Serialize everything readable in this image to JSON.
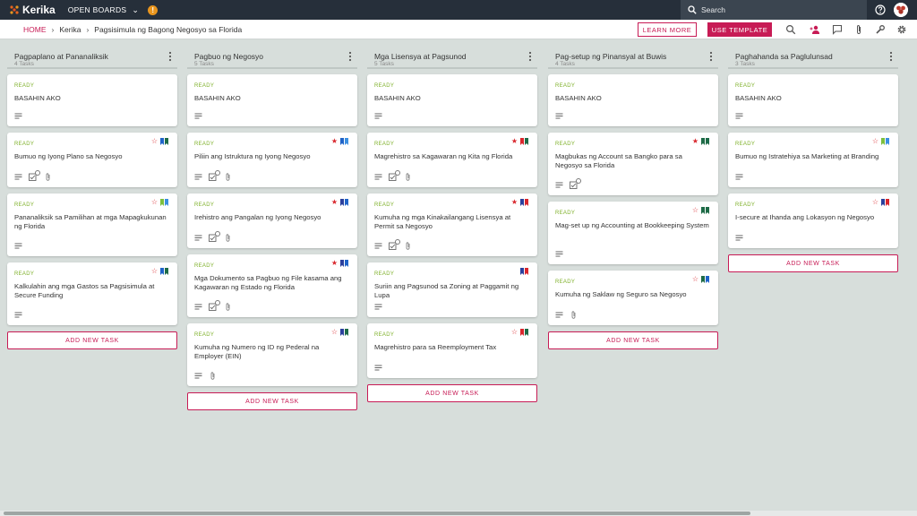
{
  "topbar": {
    "app_name": "Kerika",
    "open_boards_label": "OPEN BOARDS",
    "notification_badge": "!",
    "search_placeholder": "Search"
  },
  "breadcrumb": {
    "home": "HOME",
    "parent": "Kerika",
    "current": "Pagsisimula ng Bagong Negosyo sa Florida"
  },
  "actions": {
    "learn_more": "LEARN MORE",
    "use_template": "USE TEMPLATE"
  },
  "colors": {
    "accent": "#c71b55",
    "topbar": "#262f3a",
    "ready": "#7fb02a",
    "flag_blue": "#1e63c8",
    "flag_green": "#1e6b47",
    "flag_darkblue": "#2a3f9c",
    "flag_red": "#d9262c",
    "flag_lightgreen": "#7cbf3d",
    "flag_lightblue": "#3b8fe0",
    "star_red": "#d9262c"
  },
  "add_task_label": "ADD NEW TASK",
  "columns": [
    {
      "title": "Pagpaplano at Pananaliksik",
      "count": "4 Tasks",
      "cards": [
        {
          "status": "READY",
          "title": "BASAHIN AKO",
          "star": null,
          "flags": [],
          "icons": [
            "desc"
          ]
        },
        {
          "status": "READY",
          "title": "Bumuo ng Iyong Plano sa Negosyo",
          "star": "outline",
          "flags": [
            "#1e63c8",
            "#1e6b47"
          ],
          "icons": [
            "desc",
            "check",
            "attach"
          ]
        },
        {
          "status": "READY",
          "title": "Pananaliksik sa Pamilihan at mga Mapagkukunan ng Florida",
          "star": "outline",
          "flags": [
            "#7cbf3d",
            "#3b8fe0"
          ],
          "icons": [
            "desc"
          ]
        },
        {
          "status": "READY",
          "title": "Kalkulahin ang mga Gastos sa Pagsisimula at Secure Funding",
          "star": "outline",
          "flags": [
            "#1e63c8",
            "#1e6b47"
          ],
          "icons": [
            "desc"
          ]
        }
      ]
    },
    {
      "title": "Pagbuo ng Negosyo",
      "count": "5 Tasks",
      "cards": [
        {
          "status": "READY",
          "title": "BASAHIN AKO",
          "star": null,
          "flags": [],
          "icons": [
            "desc"
          ]
        },
        {
          "status": "READY",
          "title": "Piliin ang Istruktura ng Iyong Negosyo",
          "star": "filled",
          "flags": [
            "#1e63c8",
            "#3b8fe0"
          ],
          "icons": [
            "desc",
            "check",
            "attach"
          ]
        },
        {
          "status": "READY",
          "title": "Irehistro ang Pangalan ng Iyong Negosyo",
          "star": "filled",
          "flags": [
            "#2a3f9c",
            "#1e63c8"
          ],
          "icons": [
            "desc",
            "check",
            "attach"
          ]
        },
        {
          "status": "READY",
          "title": "Mga Dokumento sa Pagbuo ng File kasama ang Kagawaran ng Estado ng Florida",
          "star": "filled",
          "flags": [
            "#2a3f9c",
            "#1e63c8"
          ],
          "icons": [
            "desc",
            "check",
            "attach"
          ]
        },
        {
          "status": "READY",
          "title": "Kumuha ng Numero ng ID ng Pederal na Employer (EIN)",
          "star": "outline",
          "flags": [
            "#2a3f9c",
            "#1e6b47"
          ],
          "icons": [
            "desc",
            "attach"
          ]
        }
      ]
    },
    {
      "title": "Mga Lisensya at Pagsunod",
      "count": "5 Tasks",
      "cards": [
        {
          "status": "READY",
          "title": "BASAHIN AKO",
          "star": null,
          "flags": [],
          "icons": [
            "desc"
          ]
        },
        {
          "status": "READY",
          "title": "Magrehistro sa Kagawaran ng Kita ng Florida",
          "star": "filled",
          "flags": [
            "#d9262c",
            "#1e6b47"
          ],
          "icons": [
            "desc",
            "check",
            "attach"
          ]
        },
        {
          "status": "READY",
          "title": "Kumuha ng mga Kinakailangang Lisensya at Permit sa Negosyo",
          "star": "filled",
          "flags": [
            "#2a3f9c",
            "#d9262c"
          ],
          "icons": [
            "desc",
            "check",
            "attach"
          ]
        },
        {
          "status": "READY",
          "title": "Suriin ang Pagsunod sa Zoning at Paggamit ng Lupa",
          "star": null,
          "flags": [
            "#2a3f9c",
            "#d9262c"
          ],
          "icons": [
            "desc"
          ]
        },
        {
          "status": "READY",
          "title": "Magrehistro para sa Reemployment Tax",
          "star": "outline",
          "flags": [
            "#d9262c",
            "#1e6b47"
          ],
          "icons": [
            "desc"
          ]
        }
      ]
    },
    {
      "title": "Pag-setup ng Pinansyal at Buwis",
      "count": "4 Tasks",
      "cards": [
        {
          "status": "READY",
          "title": "BASAHIN AKO",
          "star": null,
          "flags": [],
          "icons": [
            "desc"
          ]
        },
        {
          "status": "READY",
          "title": "Magbukas ng Account sa Bangko para sa Negosyo sa Florida",
          "star": "filled",
          "flags": [
            "#1e6b47",
            "#1e6b47"
          ],
          "icons": [
            "desc",
            "check"
          ]
        },
        {
          "status": "READY",
          "title": "Mag-set up ng Accounting at Bookkeeping System",
          "star": "outline",
          "flags": [
            "#1e6b47",
            "#1e6b47"
          ],
          "icons": [
            "desc"
          ]
        },
        {
          "status": "READY",
          "title": "Kumuha ng Saklaw ng Seguro sa Negosyo",
          "star": "outline",
          "flags": [
            "#1e6b47",
            "#1e63c8"
          ],
          "icons": [
            "desc",
            "attach"
          ]
        }
      ]
    },
    {
      "title": "Paghahanda sa Paglulunsad",
      "count": "3 Tasks",
      "cards": [
        {
          "status": "READY",
          "title": "BASAHIN AKO",
          "star": null,
          "flags": [],
          "icons": [
            "desc"
          ]
        },
        {
          "status": "READY",
          "title": "Bumuo ng Istratehiya sa Marketing at Branding",
          "star": "outline",
          "flags": [
            "#7cbf3d",
            "#3b8fe0"
          ],
          "icons": [
            "desc"
          ]
        },
        {
          "status": "READY",
          "title": "I-secure at Ihanda ang Lokasyon ng Negosyo",
          "star": "outline",
          "flags": [
            "#2a3f9c",
            "#d9262c"
          ],
          "icons": [
            "desc"
          ]
        }
      ]
    }
  ]
}
